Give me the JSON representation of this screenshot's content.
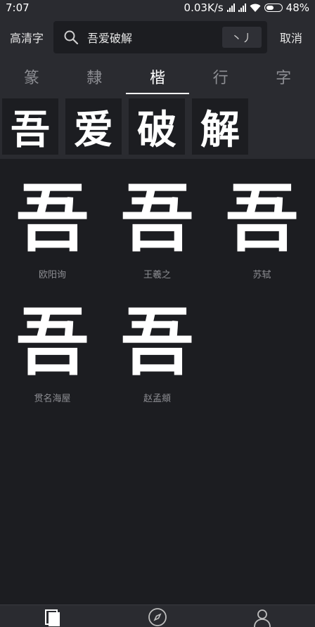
{
  "status": {
    "time": "7:07",
    "net_speed": "0.03K/s",
    "battery": "48%"
  },
  "header": {
    "hd_label": "高清字",
    "search_value": "吾爱破解",
    "stroke_button": "丶丿",
    "cancel": "取消"
  },
  "tabs": [
    "篆",
    "隸",
    "楷",
    "行",
    "字"
  ],
  "active_tab": 2,
  "chars": [
    "吾",
    "爱",
    "破",
    "解"
  ],
  "results": [
    {
      "glyph": "吾",
      "author": "欧阳询"
    },
    {
      "glyph": "吾",
      "author": "王羲之"
    },
    {
      "glyph": "吾",
      "author": "苏轼"
    },
    {
      "glyph": "吾",
      "author": "贯名海屋"
    },
    {
      "glyph": "吾",
      "author": "赵孟頫"
    }
  ],
  "nav": {
    "items": [
      "copy-icon",
      "compass-icon",
      "user-icon"
    ]
  }
}
